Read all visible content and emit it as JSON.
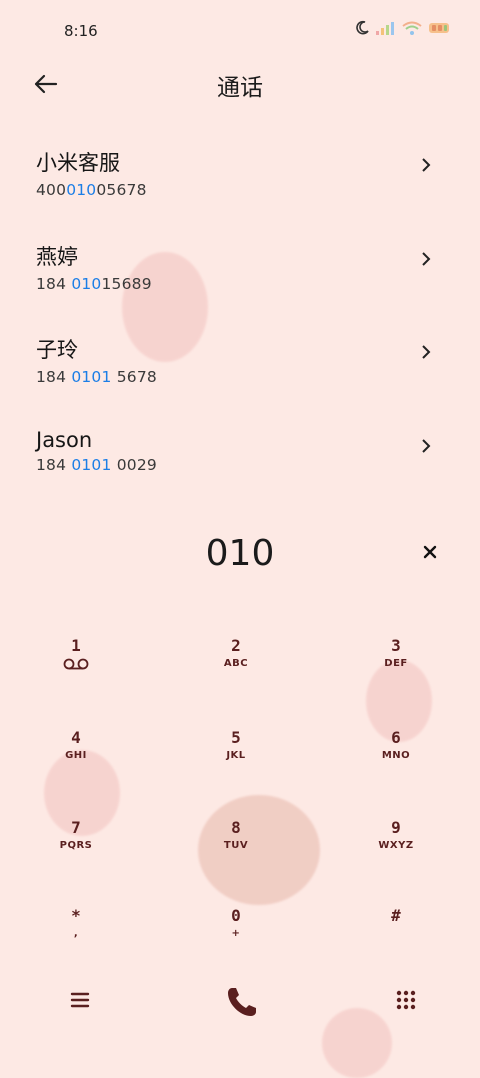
{
  "status_bar": {
    "time": "8:16"
  },
  "header": {
    "title": "通话"
  },
  "contacts": [
    {
      "name": "小米客服",
      "num_pre": "400",
      "num_hl": "010",
      "num_post": "05678"
    },
    {
      "name": "燕婷",
      "num_pre": "184 ",
      "num_hl": "010",
      "num_post": "15689"
    },
    {
      "name": "子玲",
      "num_pre": "184 ",
      "num_hl": "0101",
      "num_post": " 5678"
    },
    {
      "name": "Jason",
      "num_pre": "184 ",
      "num_hl": "0101",
      "num_post": " 0029"
    }
  ],
  "dialer": {
    "dialed_number": "010",
    "keys": [
      {
        "digit": "1",
        "letters": ""
      },
      {
        "digit": "2",
        "letters": "ABC"
      },
      {
        "digit": "3",
        "letters": "DEF"
      },
      {
        "digit": "4",
        "letters": "GHI"
      },
      {
        "digit": "5",
        "letters": "JKL"
      },
      {
        "digit": "6",
        "letters": "MNO"
      },
      {
        "digit": "7",
        "letters": "PQRS"
      },
      {
        "digit": "8",
        "letters": "TUV"
      },
      {
        "digit": "9",
        "letters": "WXYZ"
      },
      {
        "digit": "*",
        "letters": ","
      },
      {
        "digit": "0",
        "letters": "+"
      },
      {
        "digit": "#",
        "letters": ""
      }
    ]
  },
  "icons": {
    "back": "arrow-left-icon",
    "chevron": "chevron-right-icon",
    "clear": "close-icon",
    "voicemail": "voicemail-icon",
    "menu": "menu-icon",
    "call": "phone-icon",
    "dialpad": "dialpad-icon"
  },
  "colors": {
    "background": "#fde9e4",
    "highlight": "#1c7ee6",
    "key_text": "#5a1f1f"
  }
}
